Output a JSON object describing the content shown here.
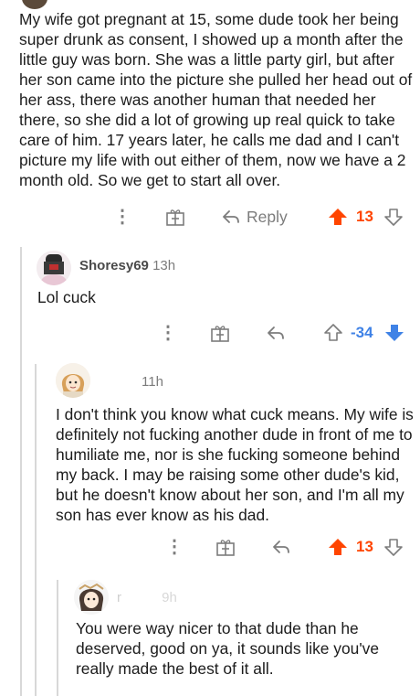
{
  "comments": [
    {
      "body": "My wife got pregnant at 15, some dude took her being super drunk as consent, I showed up a month after the little guy was born. She was a little party girl, but after her son came into the picture she pulled her head out of her ass, there was another human that needed her there, so she did a lot of growing up real quick to take care of him. 17 years later, he calls me dad and I can't picture my life with out either of them, now we have a 2 month old. So we get to start all over.",
      "reply_label": "Reply",
      "score": "13",
      "vote": "up"
    },
    {
      "username": "Shoresy69",
      "time": "13h",
      "body": "Lol cuck",
      "score": "-34",
      "vote": "down"
    },
    {
      "username": "",
      "time": "11h",
      "body": "I don't think you know what cuck means. My wife is definitely not fucking another dude in front of me to humiliate me, nor is she fucking someone behind my back. I may be raising some other dude's kid, but he doesn't know about her son, and I'm all my son has ever know as his dad.",
      "score": "13",
      "vote": "up"
    },
    {
      "username": "r",
      "time": "9h",
      "body": "You were way nicer to that dude than he deserved, good on ya, it sounds like you've really made the best of it all."
    }
  ],
  "colors": {
    "upvote": "#ff4500",
    "downvote": "#3f82e6",
    "muted": "#7c7c7c",
    "thread_line": "#d8d8d8"
  },
  "icons": [
    "more-icon",
    "gift-icon",
    "reply-icon",
    "upvote-icon",
    "downvote-icon"
  ]
}
